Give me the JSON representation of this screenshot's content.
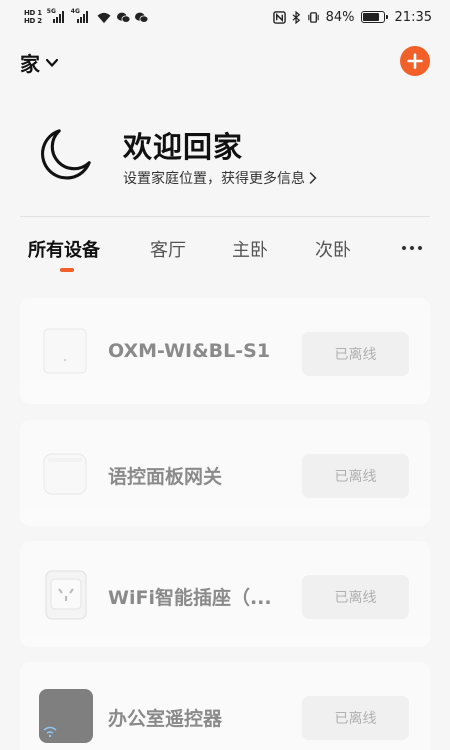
{
  "statusbar": {
    "hd1": "HD",
    "hd1_sub": "1",
    "hd2": "HD",
    "hd2_sub": "2",
    "net1": "5G",
    "net2": "4G",
    "battery_percent": "84%",
    "battery_level": 0.84,
    "time": "21:35"
  },
  "header": {
    "home_name": "家",
    "add_icon": "plus-icon"
  },
  "welcome": {
    "title": "欢迎回家",
    "subtitle": "设置家庭位置，获得更多信息",
    "icon": "moon-icon"
  },
  "tabs": [
    {
      "label": "所有设备",
      "active": true
    },
    {
      "label": "客厅",
      "active": false
    },
    {
      "label": "主卧",
      "active": false
    },
    {
      "label": "次卧",
      "active": false
    }
  ],
  "devices": [
    {
      "name": "OXM-WI&BL-S1",
      "status": "已离线",
      "icon": "router-icon"
    },
    {
      "name": "语控面板网关",
      "status": "已离线",
      "icon": "gateway-icon"
    },
    {
      "name": "WiFi智能插座（...",
      "status": "已离线",
      "icon": "smart-plug-icon"
    },
    {
      "name": "办公室遥控器",
      "status": "已离线",
      "icon": "remote-icon"
    }
  ],
  "colors": {
    "accent": "#f2602a",
    "background": "#f6f6f6"
  }
}
